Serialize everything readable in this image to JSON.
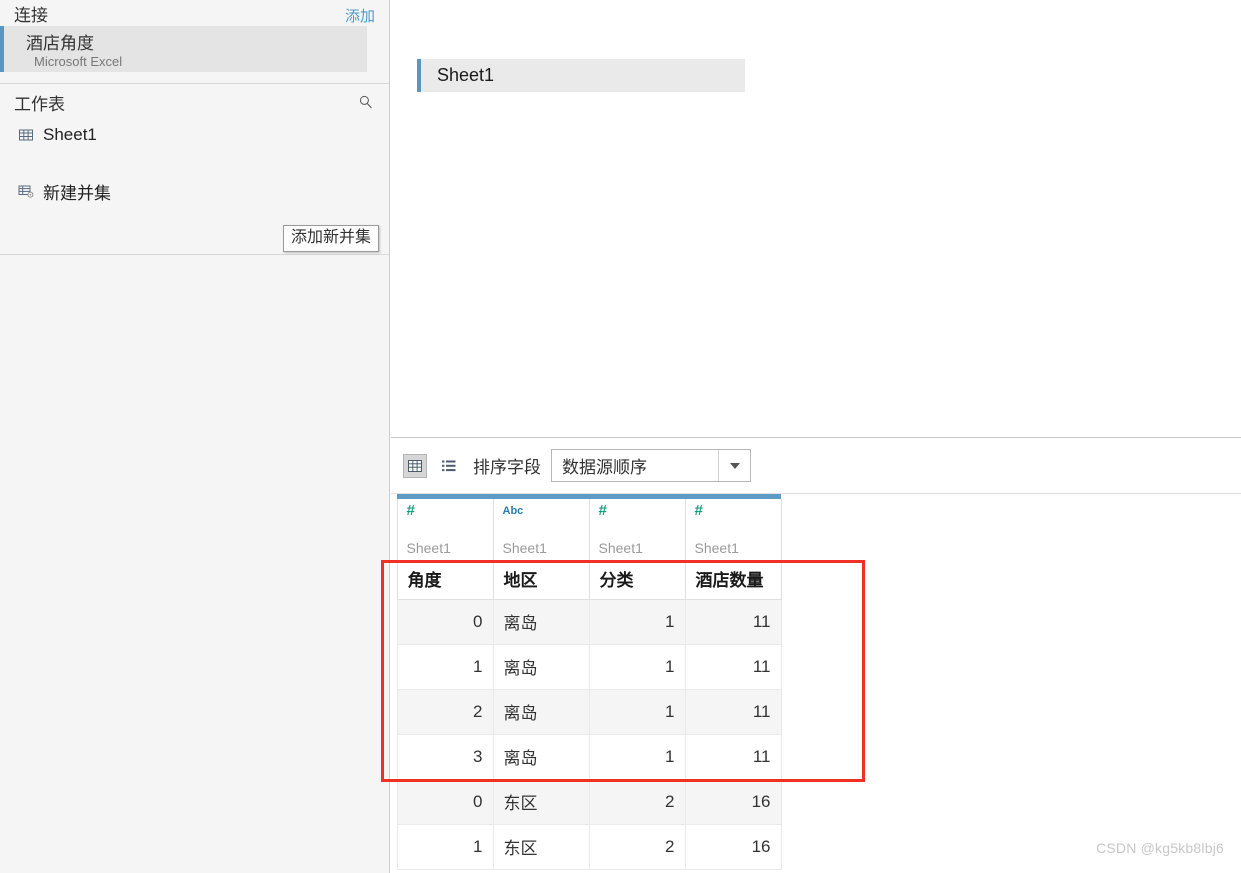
{
  "sidebar": {
    "connections": {
      "title": "连接",
      "add_label": "添加",
      "items": [
        {
          "name": "酒店角度",
          "type": "Microsoft Excel"
        }
      ]
    },
    "sheets": {
      "title": "工作表",
      "search_icon": "search-icon",
      "items": [
        {
          "label": "Sheet1",
          "icon": "table-icon"
        }
      ],
      "new_union_label": "新建并集",
      "new_union_icon": "union-icon"
    },
    "tooltip": "添加新并集"
  },
  "canvas": {
    "table_card_label": "Sheet1"
  },
  "grid": {
    "toolbar": {
      "grid_view_icon": "grid-view-icon",
      "list_view_icon": "list-view-icon",
      "sort_label": "排序字段",
      "sort_value": "数据源顺序"
    },
    "columns": [
      {
        "header": "角度",
        "type_glyph": "#",
        "type_kind": "num",
        "source": "Sheet1",
        "align": "num"
      },
      {
        "header": "地区",
        "type_glyph": "Abc",
        "type_kind": "str",
        "source": "Sheet1",
        "align": "str"
      },
      {
        "header": "分类",
        "type_glyph": "#",
        "type_kind": "num",
        "source": "Sheet1",
        "align": "num"
      },
      {
        "header": "酒店数量",
        "type_glyph": "#",
        "type_kind": "num",
        "source": "Sheet1",
        "align": "num"
      }
    ],
    "rows": [
      [
        "0",
        "离岛",
        "1",
        "11"
      ],
      [
        "1",
        "离岛",
        "1",
        "11"
      ],
      [
        "2",
        "离岛",
        "1",
        "11"
      ],
      [
        "3",
        "离岛",
        "1",
        "11"
      ],
      [
        "0",
        "东区",
        "2",
        "16"
      ],
      [
        "1",
        "东区",
        "2",
        "16"
      ]
    ]
  },
  "annotation": {
    "highlight_color": "#ef3124"
  },
  "watermark": "CSDN @kg5kb8lbj6",
  "colors": {
    "accent_blue": "#5697c4",
    "link_blue": "#4e9bc8",
    "numeric_green": "#1a9e7f",
    "string_blue": "#2a7db0",
    "highlight_red": "#ef3124"
  }
}
